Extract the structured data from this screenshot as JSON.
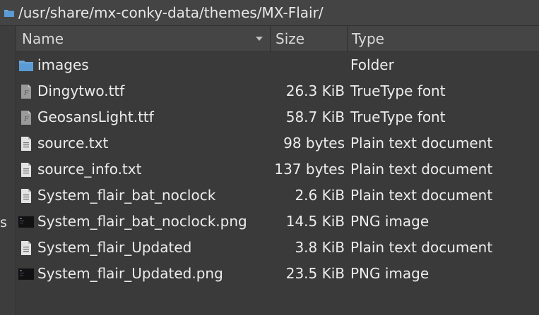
{
  "pathbar": {
    "path": "/usr/share/mx-conky-data/themes/MX-Flair/"
  },
  "sidebar": {
    "stub_text": "s"
  },
  "columns": {
    "name": "Name",
    "size": "Size",
    "type": "Type"
  },
  "files": [
    {
      "name": "images",
      "size": "",
      "type": "Folder",
      "icon": "folder-icon"
    },
    {
      "name": "Dingytwo.ttf",
      "size": "26.3 KiB",
      "type": "TrueType font",
      "icon": "font-file-icon"
    },
    {
      "name": "GeosansLight.ttf",
      "size": "58.7 KiB",
      "type": "TrueType font",
      "icon": "font-file-icon"
    },
    {
      "name": "source.txt",
      "size": "98 bytes",
      "type": "Plain text document",
      "icon": "text-file-icon"
    },
    {
      "name": "source_info.txt",
      "size": "137 bytes",
      "type": "Plain text document",
      "icon": "text-file-icon"
    },
    {
      "name": "System_flair_bat_noclock",
      "size": "2.6 KiB",
      "type": "Plain text document",
      "icon": "text-file-icon"
    },
    {
      "name": "System_flair_bat_noclock.png",
      "size": "14.5 KiB",
      "type": "PNG image",
      "icon": "image-thumbnail-icon"
    },
    {
      "name": "System_flair_Updated",
      "size": "3.8 KiB",
      "type": "Plain text document",
      "icon": "text-file-icon"
    },
    {
      "name": "System_flair_Updated.png",
      "size": "23.5 KiB",
      "type": "PNG image",
      "icon": "image-thumbnail-icon"
    }
  ],
  "colors": {
    "folder": "#5b9bd5",
    "background": "#3a3a3a",
    "header": "#454545"
  }
}
